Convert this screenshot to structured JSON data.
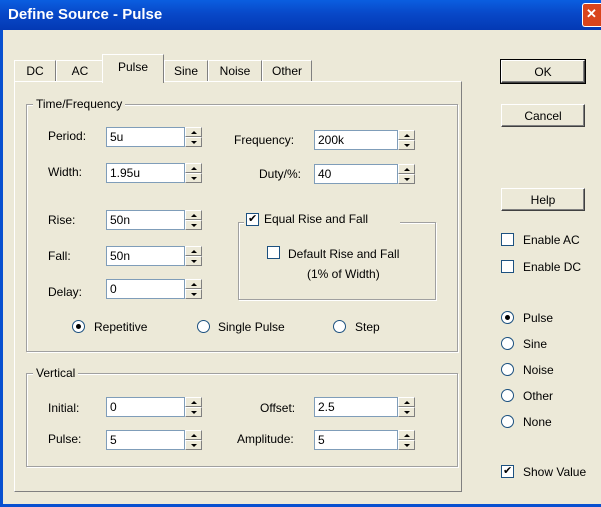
{
  "window": {
    "title": "Define Source - Pulse"
  },
  "tabs": [
    {
      "label": "DC"
    },
    {
      "label": "AC"
    },
    {
      "label": "Pulse"
    },
    {
      "label": "Sine"
    },
    {
      "label": "Noise"
    },
    {
      "label": "Other"
    }
  ],
  "active_tab": "Pulse",
  "time_freq": {
    "title": "Time/Frequency",
    "period": {
      "label": "Period:",
      "value": "5u"
    },
    "width": {
      "label": "Width:",
      "value": "1.95u"
    },
    "rise": {
      "label": "Rise:",
      "value": "50n"
    },
    "fall": {
      "label": "Fall:",
      "value": "50n"
    },
    "delay": {
      "label": "Delay:",
      "value": "0"
    },
    "frequency": {
      "label": "Frequency:",
      "value": "200k"
    },
    "duty": {
      "label": "Duty/%:",
      "value": "40"
    },
    "equal_rise_fall": {
      "label": "Equal Rise and Fall",
      "checked": true
    },
    "default_rise_fall": {
      "label": "Default Rise and Fall",
      "sublabel": "(1% of Width)",
      "checked": false
    },
    "modes": [
      {
        "label": "Repetitive",
        "selected": true
      },
      {
        "label": "Single Pulse",
        "selected": false
      },
      {
        "label": "Step",
        "selected": false
      }
    ]
  },
  "vertical": {
    "title": "Vertical",
    "initial": {
      "label": "Initial:",
      "value": "0"
    },
    "pulse": {
      "label": "Pulse:",
      "value": "5"
    },
    "offset": {
      "label": "Offset:",
      "value": "2.5"
    },
    "amplitude": {
      "label": "Amplitude:",
      "value": "5"
    }
  },
  "buttons": {
    "ok": "OK",
    "cancel": "Cancel",
    "help": "Help"
  },
  "enable_ac": {
    "label": "Enable AC",
    "checked": false
  },
  "enable_dc": {
    "label": "Enable DC",
    "checked": false
  },
  "source_types": [
    {
      "label": "Pulse",
      "selected": true
    },
    {
      "label": "Sine",
      "selected": false
    },
    {
      "label": "Noise",
      "selected": false
    },
    {
      "label": "Other",
      "selected": false
    },
    {
      "label": "None",
      "selected": false
    }
  ],
  "show_value": {
    "label": "Show Value",
    "checked": true
  }
}
